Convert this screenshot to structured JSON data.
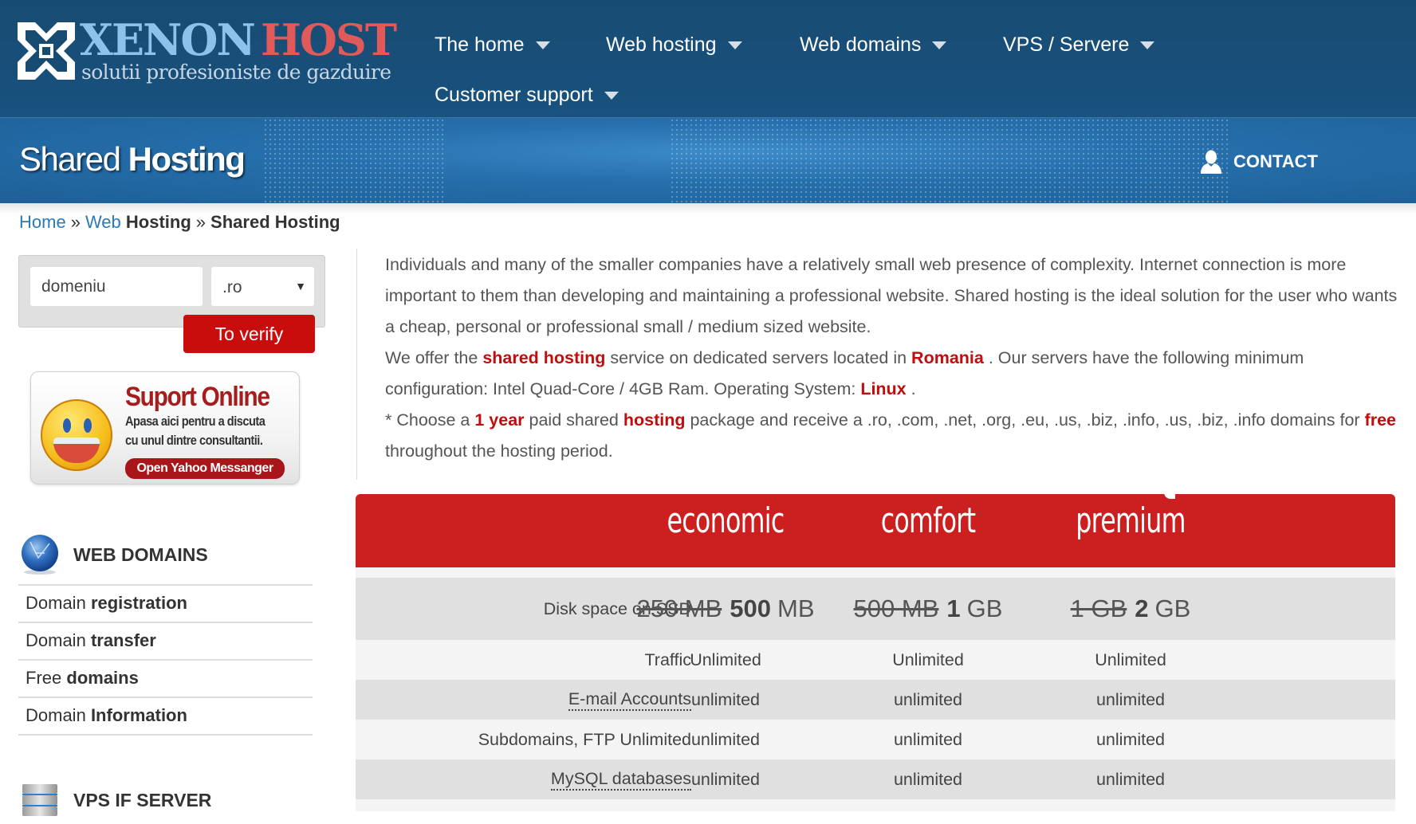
{
  "brand": {
    "name_part1": "XENON",
    "name_part2": "HOST",
    "tagline": "solutii profesioniste de gazduire",
    "colors": {
      "primary": "#174b72",
      "accent_red": "#c90d0d",
      "logo_blue": "#8ec2ea",
      "logo_red": "#e05a59"
    }
  },
  "nav": {
    "items": [
      {
        "label": "The home",
        "icon": "caret-down-icon"
      },
      {
        "label": "Web hosting",
        "icon": "caret-down-icon"
      },
      {
        "label": "Web domains",
        "icon": "caret-down-icon"
      },
      {
        "label": "VPS / Servere",
        "icon": "caret-down-icon"
      },
      {
        "label": "Customer support",
        "icon": "caret-down-icon"
      }
    ]
  },
  "banner": {
    "title_light": "Shared",
    "title_bold": "Hosting",
    "contact_label": "CONTACT",
    "contact_icon": "user-icon"
  },
  "breadcrumb": {
    "home": "Home",
    "sep": "»",
    "web": "Web",
    "hosting": "Hosting",
    "current": "Shared Hosting"
  },
  "domain_search": {
    "input_value": "domeniu",
    "tld_selected": ".ro",
    "button_label": "To verify"
  },
  "support_banner": {
    "title": "Suport Online",
    "line1": "Apasa aici pentru a discuta",
    "line2": "cu unul dintre consultantii.",
    "button": "Open Yahoo Messanger"
  },
  "sidebar": {
    "web_domains": {
      "heading": "WEB DOMAINS",
      "icon": "globe-icon",
      "items": [
        {
          "light": "Domain",
          "bold": "registration"
        },
        {
          "light": "Domain",
          "bold": "transfer"
        },
        {
          "light": "Free",
          "bold": "domains"
        },
        {
          "light": "Domain",
          "bold": "Information"
        }
      ]
    },
    "vps": {
      "heading": "VPS IF SERVER",
      "icon": "server-icon"
    }
  },
  "intro": {
    "p1": "Individuals and many of the smaller companies have a relatively small web presence of complexity. Internet connection is more important to them than developing and maintaining a professional website. Shared hosting is the ideal solution for the user who wants a cheap, personal or professional small / medium sized website.",
    "p2_a": "We offer the ",
    "p2_hl1": "shared hosting",
    "p2_b": " service on dedicated servers located in ",
    "p2_hl2": "Romania",
    "p2_c": " . Our servers have the following minimum configuration: Intel Quad-Core / 4GB Ram. Operating System: ",
    "p2_hl3": "Linux",
    "p2_d": " .",
    "p3_a": "* Choose a ",
    "p3_hl1": "1 year",
    "p3_b": " paid shared ",
    "p3_hl2": "hosting",
    "p3_c": " package and receive a .ro, .com, .net, .org, .eu, .us, .biz, .info, .us, .biz, .info domains for ",
    "p3_hl3": "free",
    "p3_d": " throughout the hosting period."
  },
  "pricing": {
    "plans": [
      "economic",
      "comfort",
      "premium"
    ],
    "disk": {
      "label": "Disk space on SSD",
      "values": [
        {
          "old": "250 MB",
          "new_num": "500",
          "new_unit": "MB"
        },
        {
          "old": "500 MB",
          "new_num": "1",
          "new_unit": "GB"
        },
        {
          "old": "1 GB",
          "new_num": "2",
          "new_unit": "GB"
        }
      ]
    },
    "rows": [
      {
        "label": "Traffic",
        "values": [
          "Unlimited",
          "Unlimited",
          "Unlimited"
        ]
      },
      {
        "label": "E-mail Accounts",
        "values": [
          "unlimited",
          "unlimited",
          "unlimited"
        ]
      },
      {
        "label": "Subdomains, FTP Unlimited",
        "values": [
          "unlimited",
          "unlimited",
          "unlimited"
        ]
      },
      {
        "label": "MySQL databases",
        "values": [
          "unlimited",
          "unlimited",
          "unlimited"
        ]
      }
    ]
  }
}
